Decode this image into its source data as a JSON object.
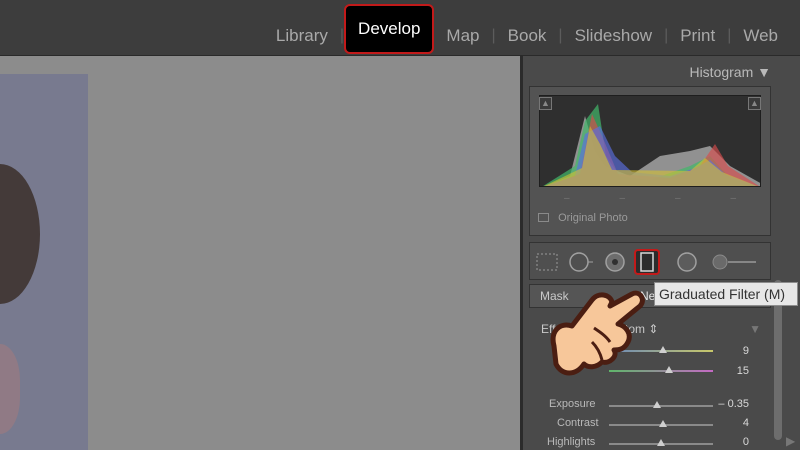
{
  "modules": {
    "items": [
      "Library",
      "Develop",
      "Map",
      "Book",
      "Slideshow",
      "Print",
      "Web"
    ],
    "active": "Develop"
  },
  "histogram": {
    "title": "Histogram",
    "collapse_icon": "triangle-down-icon",
    "ticks": [
      "–",
      "–",
      "–",
      "–"
    ],
    "original_photo_label": "Original Photo"
  },
  "tools": {
    "items": [
      "crop-overlay-icon",
      "spot-removal-icon",
      "red-eye-icon",
      "graduated-filter-icon",
      "radial-filter-icon",
      "adjustment-brush-icon"
    ],
    "active": "graduated-filter-icon",
    "tooltip": "Graduated Filter (M)"
  },
  "mask": {
    "label": "Mask",
    "new_label": "Ne"
  },
  "effect": {
    "label": "Eff",
    "value": "tom ⇕",
    "temp_value": "9",
    "tint_value": "15",
    "exposure_label": "Exposure",
    "exposure_value": "– 0.35",
    "contrast_label": "Contrast",
    "contrast_value": "4",
    "highlights_label": "Highlights",
    "highlights_value": "0"
  },
  "colors": {
    "accent": "#c21a1a",
    "panel": "#4a4a4a",
    "canvas": "#8c8c8c"
  }
}
